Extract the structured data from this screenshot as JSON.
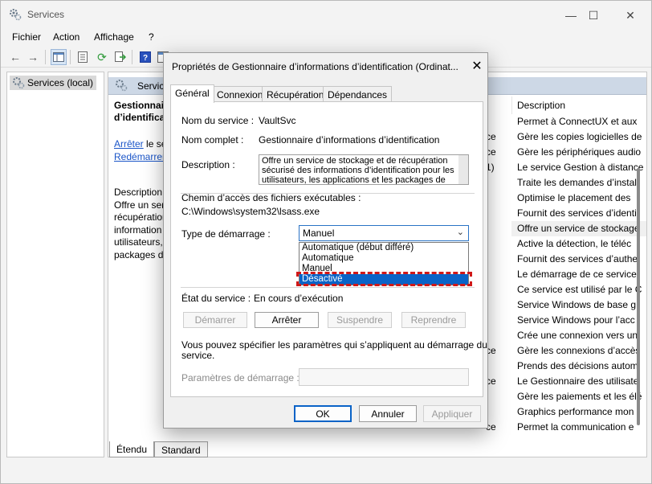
{
  "window": {
    "title": "Services",
    "min": "—",
    "max": "☐",
    "close": "✕"
  },
  "menu": [
    "Fichier",
    "Action",
    "Affichage",
    "?"
  ],
  "tree": {
    "root_label": "Services (local)"
  },
  "content": {
    "header": "Services",
    "detail_title": "Gestionnaire d’identificati",
    "link_stop": "Arrêter",
    "link_stop_suffix": " le serv",
    "link_restart": "Redémarrer",
    "link_restart_suffix": " le",
    "desc_label": "Description",
    "desc_lines": [
      "Offre un serv",
      "récupération",
      "information",
      "utilisateurs,",
      "packages de"
    ],
    "column_header": "Description",
    "mid_values": [
      "",
      "ce",
      "ce",
      "1)",
      "",
      "",
      "",
      "",
      "",
      "",
      "",
      "",
      "",
      "",
      "",
      "ce",
      "",
      "ce",
      "",
      "",
      "ce",
      "",
      ""
    ],
    "descriptions": [
      "Permet à ConnectUX et aux",
      "Gère les copies logicielles de",
      "Gère les périphériques audio",
      "Le service Gestion à distance",
      "Traite les demandes d’install",
      "Optimise le placement des",
      "Fournit des services d’identi",
      "Offre un service de stockage",
      "Active la détection, le téléc",
      "Fournit des services d’authe",
      "Le démarrage de ce service",
      "Ce service est utilisé par le C",
      "Service Windows de base g",
      "Service Windows pour l’acc",
      "Crée une connexion vers un",
      "Gère les connexions d’accès",
      "Prends des décisions autom",
      "Le Gestionnaire des utilisate",
      "Gère les paiements et les élé",
      "Graphics performance mon",
      "Permet la communication e"
    ],
    "selected_index": 7
  },
  "bottom_tabs": [
    "Étendu",
    "Standard"
  ],
  "dialog": {
    "title": "Propriétés de Gestionnaire d’informations d’identification (Ordinat...",
    "close": "✕",
    "tabs": [
      "Général",
      "Connexion",
      "Récupération",
      "Dépendances"
    ],
    "active_tab": 0,
    "service_name_label": "Nom du service :",
    "service_name": "VaultSvc",
    "display_name_label": "Nom complet :",
    "display_name": "Gestionnaire d’informations d’identification",
    "description_label": "Description :",
    "description_lines": [
      "Offre un service de stockage et de récupération",
      "sécurisé des informations d’identification pour les",
      "utilisateurs, les applications et les packages de"
    ],
    "exe_path_label": "Chemin d’accès des fichiers exécutables :",
    "exe_path": "C:\\Windows\\system32\\lsass.exe",
    "startup_type_label": "Type de démarrage :",
    "startup_type_value": "Manuel",
    "startup_options": [
      "Automatique (début différé)",
      "Automatique",
      "Manuel",
      "Désactivé"
    ],
    "startup_selected": 3,
    "status_label": "État du service :",
    "status_value": "En cours d’exécution",
    "buttons": {
      "start": "Démarrer",
      "stop": "Arrêter",
      "pause": "Suspendre",
      "resume": "Reprendre"
    },
    "params_note_1": "Vous pouvez spécifier les paramètres qui s’appliquent au démarrage du",
    "params_note_2": "service.",
    "params_label": "Paramètres de démarrage :",
    "params_value": "",
    "ok": "OK",
    "cancel": "Annuler",
    "apply": "Appliquer"
  },
  "colors": {
    "selection": "#0a63c7",
    "highlight": "#d01818",
    "link": "#1a55c8"
  }
}
